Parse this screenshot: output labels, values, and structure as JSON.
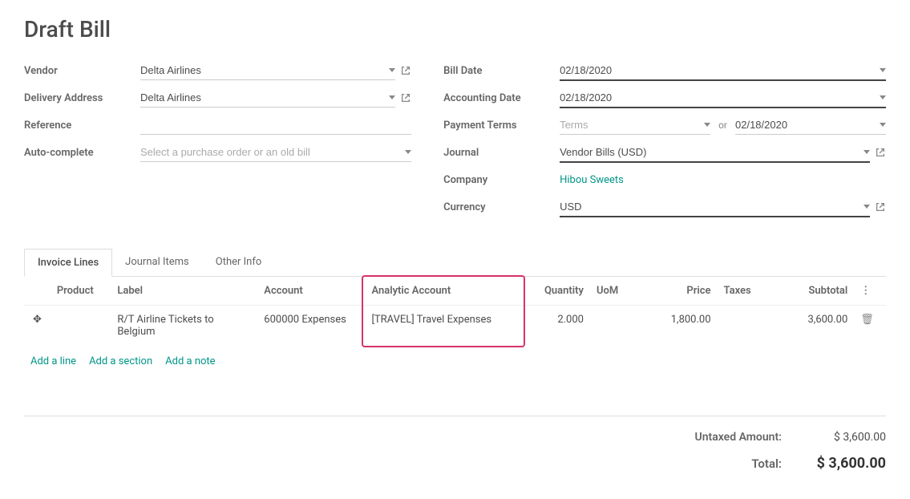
{
  "title": "Draft Bill",
  "left_fields": {
    "vendor_label": "Vendor",
    "vendor_value": "Delta Airlines",
    "delivery_label": "Delivery Address",
    "delivery_value": "Delta Airlines",
    "reference_label": "Reference",
    "reference_value": "",
    "autocomplete_label": "Auto-complete",
    "autocomplete_placeholder": "Select a purchase order or an old bill"
  },
  "right_fields": {
    "bill_date_label": "Bill Date",
    "bill_date_value": "02/18/2020",
    "accounting_date_label": "Accounting Date",
    "accounting_date_value": "02/18/2020",
    "payment_terms_label": "Payment Terms",
    "payment_terms_placeholder": "Terms",
    "payment_terms_or": "or",
    "payment_due_value": "02/18/2020",
    "journal_label": "Journal",
    "journal_value": "Vendor Bills (USD)",
    "company_label": "Company",
    "company_value": "Hibou Sweets",
    "currency_label": "Currency",
    "currency_value": "USD"
  },
  "tabs": [
    "Invoice Lines",
    "Journal Items",
    "Other Info"
  ],
  "columns": {
    "product": "Product",
    "label": "Label",
    "account": "Account",
    "analytic": "Analytic Account",
    "quantity": "Quantity",
    "uom": "UoM",
    "price": "Price",
    "taxes": "Taxes",
    "subtotal": "Subtotal"
  },
  "rows": [
    {
      "product": "",
      "label": "R/T Airline Tickets to Belgium",
      "account": "600000 Expenses",
      "analytic": "[TRAVEL] Travel Expenses",
      "quantity": "2.000",
      "uom": "",
      "price": "1,800.00",
      "taxes": "",
      "subtotal": "3,600.00"
    }
  ],
  "line_actions": {
    "add_line": "Add a line",
    "add_section": "Add a section",
    "add_note": "Add a note"
  },
  "totals": {
    "untaxed_label": "Untaxed Amount:",
    "untaxed_value": "$ 3,600.00",
    "total_label": "Total:",
    "total_value": "$ 3,600.00"
  }
}
